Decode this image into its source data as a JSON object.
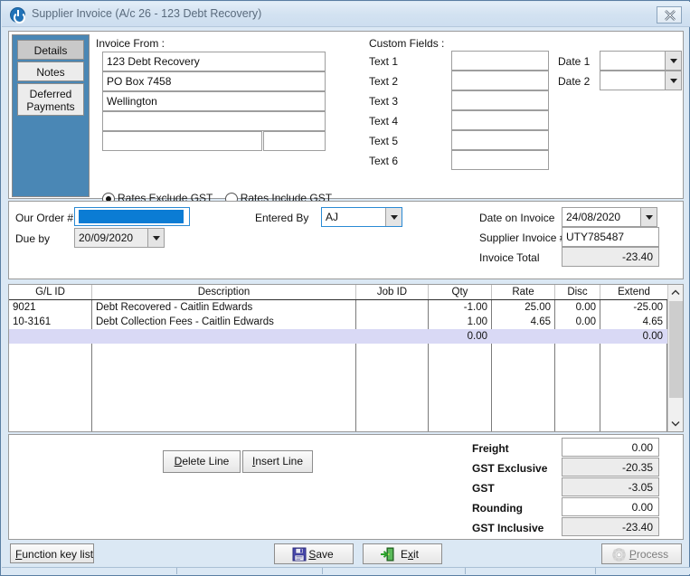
{
  "window": {
    "title": "Supplier Invoice (A/c 26 - 123 Debt Recovery)",
    "icon": "power-icon",
    "close_label": "close-icon"
  },
  "tabs": [
    {
      "label": "Details",
      "active": true
    },
    {
      "label": "Notes",
      "active": false
    },
    {
      "label": "Deferred Payments",
      "active": false
    }
  ],
  "invoice_from": {
    "heading": "Invoice From :",
    "line1": "123 Debt Recovery",
    "line2": "PO Box 7458",
    "line3": "Wellington",
    "line4": "",
    "line5a": "",
    "line5b": ""
  },
  "gst_mode": {
    "exclude_label": "Rates Exclude GST",
    "include_label": "Rates Include GST",
    "selected": "exclude"
  },
  "custom_fields": {
    "heading": "Custom Fields  :",
    "texts": [
      {
        "label": "Text 1",
        "value": ""
      },
      {
        "label": "Text 2",
        "value": ""
      },
      {
        "label": "Text 3",
        "value": ""
      },
      {
        "label": "Text 4",
        "value": ""
      },
      {
        "label": "Text 5",
        "value": ""
      },
      {
        "label": "Text 6",
        "value": ""
      }
    ],
    "dates": [
      {
        "label": "Date 1",
        "value": ""
      },
      {
        "label": "Date 2",
        "value": ""
      }
    ]
  },
  "order": {
    "our_order_label": "Our Order #",
    "our_order_value": "",
    "due_by_label": "Due by",
    "due_by_value": "20/09/2020",
    "entered_by_label": "Entered By",
    "entered_by_value": "AJ",
    "date_on_invoice_label": "Date on Invoice",
    "date_on_invoice_value": "24/08/2020",
    "supplier_invoice_label": "Supplier Invoice #",
    "supplier_invoice_value": "UTY785487",
    "invoice_total_label": "Invoice Total",
    "invoice_total_value": "-23.40"
  },
  "grid": {
    "columns": [
      "G/L ID",
      "Description",
      "Job ID",
      "Qty",
      "Rate",
      "Disc",
      "Extend"
    ],
    "rows": [
      {
        "gl_id": "9021",
        "description": "Debt Recovered - Caitlin Edwards",
        "job_id": "",
        "qty": "-1.00",
        "rate": "25.00",
        "disc": "0.00",
        "extend": "-25.00",
        "selected": false
      },
      {
        "gl_id": "10-3161",
        "description": "Debt Collection Fees - Caitlin Edwards",
        "job_id": "",
        "qty": "1.00",
        "rate": "4.65",
        "disc": "0.00",
        "extend": "4.65",
        "selected": false
      },
      {
        "gl_id": "",
        "description": "",
        "job_id": "",
        "qty": "0.00",
        "rate": "",
        "disc": "",
        "extend": "0.00",
        "selected": true
      }
    ]
  },
  "line_buttons": {
    "delete": "Delete Line",
    "delete_accel": "D",
    "insert": "Insert Line",
    "insert_accel": "I"
  },
  "totals": [
    {
      "label": "Freight",
      "value": "0.00",
      "readonly": false
    },
    {
      "label": "GST Exclusive",
      "value": "-20.35",
      "readonly": true
    },
    {
      "label": "GST",
      "value": "-3.05",
      "readonly": true
    },
    {
      "label": "Rounding",
      "value": "0.00",
      "readonly": false
    },
    {
      "label": "GST Inclusive",
      "value": "-23.40",
      "readonly": true
    }
  ],
  "actions": {
    "function_key_list": "Function key list",
    "function_key_accel": "F",
    "save": "Save",
    "save_accel": "S",
    "save_icon": "floppy-disk-icon",
    "exit": "Exit",
    "exit_accel": "x",
    "exit_icon": "exit-door-icon",
    "process": "Process",
    "process_accel": "P",
    "process_icon": "gear-icon",
    "process_disabled": true
  },
  "colors": {
    "accent": "#4a87b5",
    "titlebar": "#d3e2f1",
    "selection": "#d9d9f5",
    "focus_border": "#2a8ad4",
    "highlight_blue": "#0b7cd4"
  }
}
